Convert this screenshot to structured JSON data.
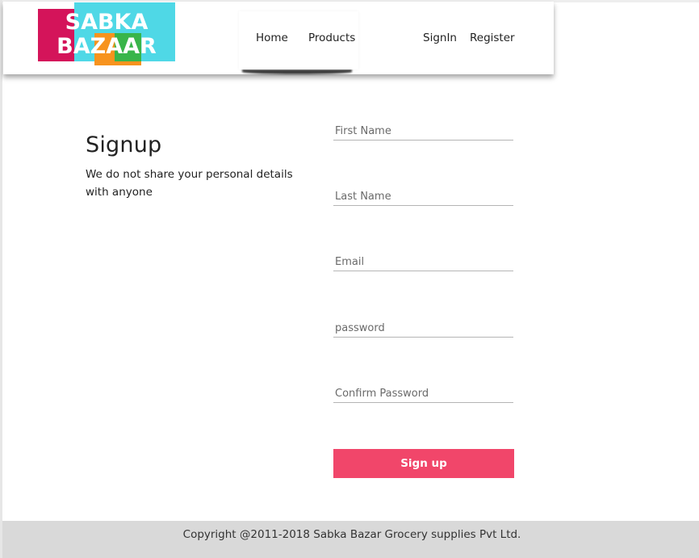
{
  "brand": {
    "logo_line1": "SABKA",
    "logo_line2": "BAZAAR",
    "colors": {
      "magenta": "#d4145a",
      "orange": "#f7931e",
      "green": "#39b54a",
      "cyan": "#4fd8e6"
    }
  },
  "nav": {
    "home": "Home",
    "products": "Products",
    "signin": "SignIn",
    "register": "Register"
  },
  "intro": {
    "title": "Signup",
    "subtitle": "We do not share your personal details with anyone"
  },
  "form": {
    "first_name_placeholder": "First Name",
    "last_name_placeholder": "Last Name",
    "email_placeholder": "Email",
    "password_placeholder": "password",
    "confirm_password_placeholder": "Confirm Password",
    "submit_label": "Sign up",
    "accent_color": "#f1466a"
  },
  "footer": {
    "copyright": "Copyright @2011-2018 Sabka Bazar Grocery supplies Pvt Ltd."
  }
}
